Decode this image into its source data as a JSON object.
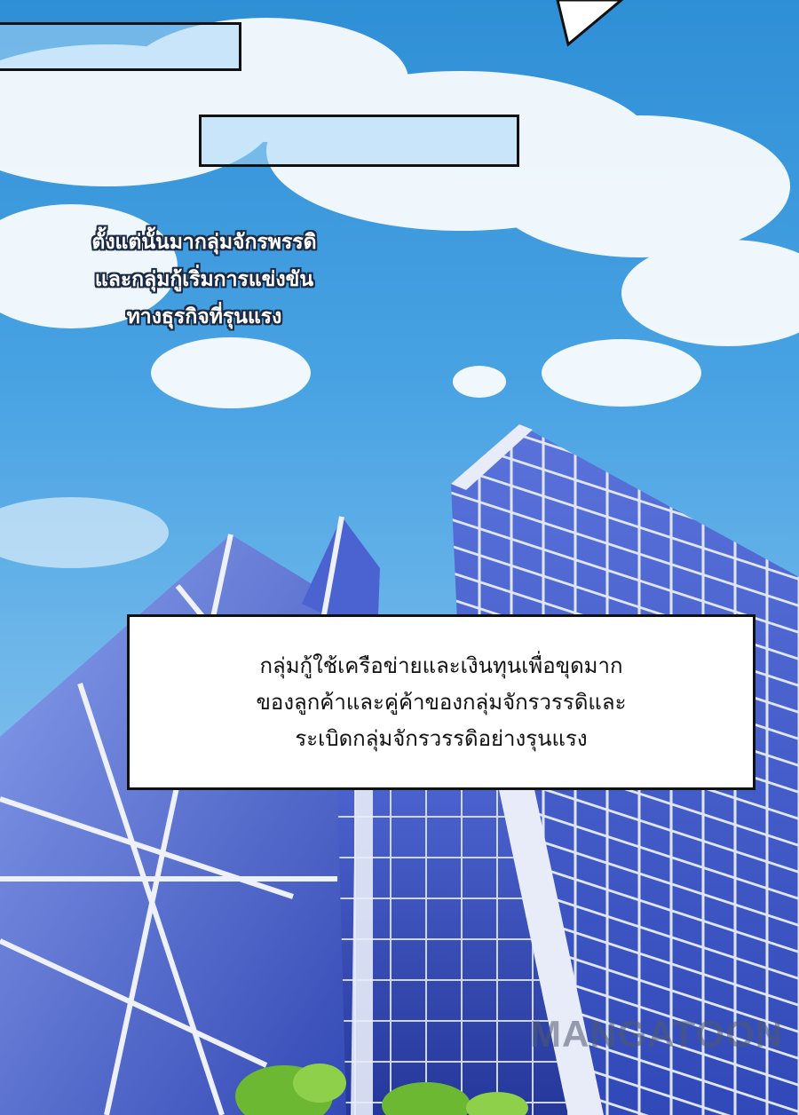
{
  "narration_top": {
    "lines": [
      "ตั้งแต่นั้นมากลุ่มจักรพรรดิ",
      "และกลุ่มกู้เริ่มการแข่งขัน",
      "ทางธุรกิจที่รุนแรง"
    ]
  },
  "caption_box": {
    "lines": [
      "กลุ่มกู้ใช้เครือข่ายและเงินทุนเพื่อขุดมาก",
      "ของลูกค้าและคู่ค้าของกลุ่มจักรวรรดิและ",
      "ระเบิดกลุ่มจักรวรรดิอย่างรุนแรง"
    ]
  },
  "watermark": {
    "text": "MANGATOON"
  },
  "colors": {
    "sky_top": "#2f8fd6",
    "sky_bottom": "#9fcdf0",
    "glass_blue": "#3c56c4",
    "glass_light": "#7e95e6",
    "frame": "#e8ecf8",
    "tree_green": "#6cb833"
  }
}
